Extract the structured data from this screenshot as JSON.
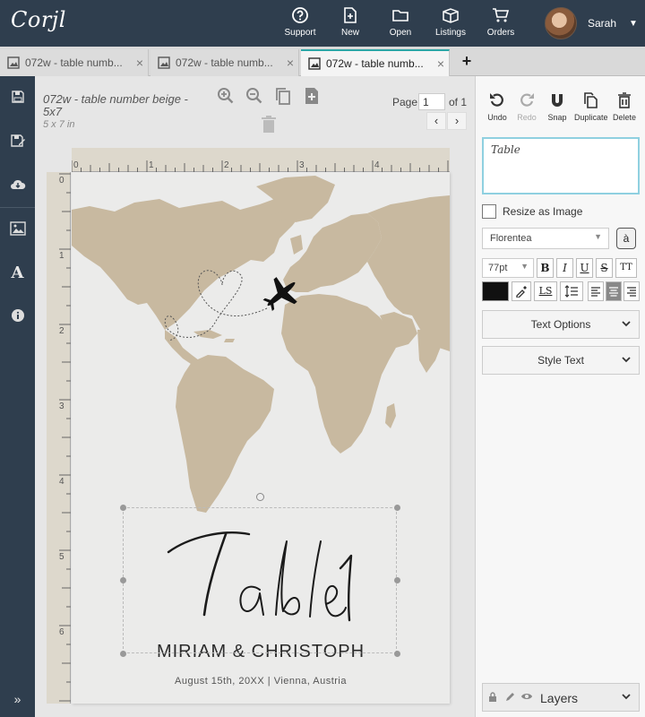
{
  "app": {
    "logo": "Corjl"
  },
  "topnav": {
    "items": [
      {
        "label": "Support",
        "icon": "question-circle-icon"
      },
      {
        "label": "New",
        "icon": "new-file-icon"
      },
      {
        "label": "Open",
        "icon": "folder-icon"
      },
      {
        "label": "Listings",
        "icon": "box-icon"
      },
      {
        "label": "Orders",
        "icon": "cart-icon"
      }
    ],
    "user": {
      "name": "Sarah"
    }
  },
  "tabs": [
    {
      "label": "072w - table numb...",
      "close": "×"
    },
    {
      "label": "072w - table numb...",
      "close": "×"
    },
    {
      "label": "072w - table numb...",
      "close": "×"
    }
  ],
  "tab_add": "+",
  "document": {
    "title": "072w - table number beige - 5x7",
    "size": "5 x 7 in",
    "page_label": "Page",
    "page_value": "1",
    "page_of": "of 1"
  },
  "ruler": {
    "h_labels": [
      "0",
      "1",
      "2",
      "3",
      "4"
    ],
    "v_labels": [
      "0",
      "1",
      "2",
      "3",
      "4",
      "5",
      "6"
    ]
  },
  "design": {
    "table_text": "Table 1",
    "couple": "MIRIAM & CHRISTOPH",
    "event": "August 15th, 20XX | Vienna, Austria"
  },
  "right_panel": {
    "actions": [
      {
        "label": "Undo",
        "icon": "undo-icon",
        "enabled": true
      },
      {
        "label": "Redo",
        "icon": "redo-icon",
        "enabled": false
      },
      {
        "label": "Snap",
        "icon": "magnet-icon",
        "enabled": true
      },
      {
        "label": "Duplicate",
        "icon": "duplicate-icon",
        "enabled": true
      },
      {
        "label": "Delete",
        "icon": "trash-icon",
        "enabled": true
      }
    ],
    "text_value": "Table",
    "resize_label": "Resize as Image",
    "font": "Florentea",
    "font_preview": "à",
    "font_size": "77pt",
    "format_buttons": [
      "B",
      "I",
      "U",
      "S",
      "TT"
    ],
    "ls_label": "LS",
    "text_color": "#111111",
    "text_options": "Text Options",
    "style_text": "Style Text",
    "layers": "Layers"
  },
  "colors": {
    "navbar": "#2f3e4e",
    "accent": "#2aa6a6",
    "map": "#c8b9a0",
    "page": "#ebebea"
  }
}
